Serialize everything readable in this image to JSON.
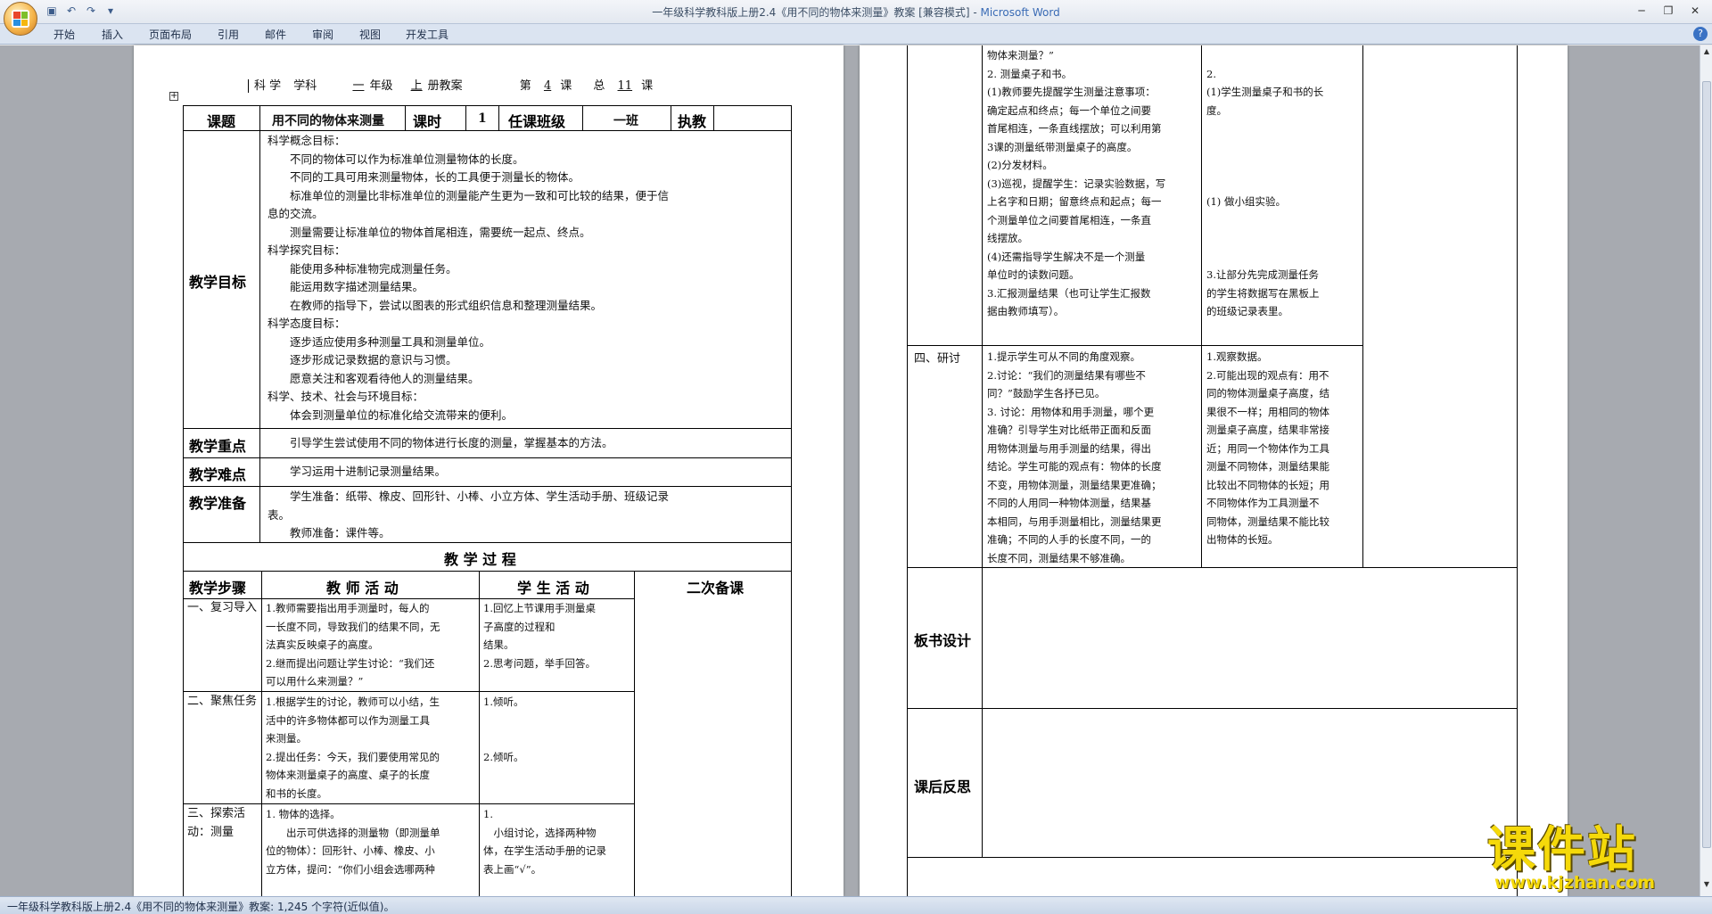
{
  "window": {
    "title": "一年级科学教科版上册2.4《用不同的物体来测量》教案 [兼容模式] - ",
    "app_name": "Microsoft Word"
  },
  "ribbon": {
    "tabs": [
      "开始",
      "插入",
      "页面布局",
      "引用",
      "邮件",
      "审阅",
      "视图",
      "开发工具"
    ]
  },
  "header_line": {
    "subject": "科 学",
    "subject_suffix": "学科",
    "grade": "一",
    "grade_suffix": "年级",
    "volume": "上",
    "volume_suffix": "册教案",
    "lesson_prefix": "第",
    "lesson_no": "4",
    "lesson_suffix": "课",
    "total_prefix": "总",
    "total_no": "11",
    "total_suffix": "课"
  },
  "info_row": {
    "topic_label": "课题",
    "topic": "用不同的物体来测量",
    "hours_label": "课时",
    "hours": "1",
    "class_label": "任课班级",
    "class": "一班",
    "teacher_label": "执教"
  },
  "objectives": {
    "label": "教学目标",
    "lines": [
      "科学概念目标：",
      "　　不同的物体可以作为标准单位测量物体的长度。",
      "　　不同的工具可用来测量物体，长的工具便于测量长的物体。",
      "　　标准单位的测量比非标准单位的测量能产生更为一致和可比较的结果，便于信",
      "息的交流。",
      "　　测量需要让标准单位的物体首尾相连，需要统一起点、终点。",
      "科学探究目标：",
      "　　能使用多种标准物完成测量任务。",
      "　　能运用数字描述测量结果。",
      "　　在教师的指导下，尝试以图表的形式组织信息和整理测量结果。",
      "科学态度目标：",
      "　　逐步适应使用多种测量工具和测量单位。",
      "　　逐步形成记录数据的意识与习惯。",
      "　　愿意关注和客观看待他人的测量结果。",
      "科学、技术、社会与环境目标：",
      "　　体会到测量单位的标准化给交流带来的便利。"
    ]
  },
  "key_point": {
    "label": "教学重点",
    "text": "　　引导学生尝试使用不同的物体进行长度的测量，掌握基本的方法。"
  },
  "difficulty": {
    "label": "教学难点",
    "text": "　　学习运用十进制记录测量结果。"
  },
  "preparation": {
    "label": "教学准备",
    "lines": [
      "　　学生准备：纸带、橡皮、回形针、小棒、小立方体、学生活动手册、班级记录",
      "表。",
      "　　教师准备：课件等。"
    ]
  },
  "process_title": "教 学 过 程",
  "process_headers": {
    "step": "教学步骤",
    "teacher": "教 师 活 动",
    "student": "学 生 活 动",
    "revise": "二次备课"
  },
  "steps_left": [
    {
      "step": "一、复习导入",
      "teacher": [
        "1.教师需要指出用手测量时，每人的",
        "一长度不同，导致我们的结果不同，无",
        "法真实反映桌子的高度。",
        "2.继而提出问题让学生讨论：“我们还",
        "可以用什么来测量？”"
      ],
      "student": [
        "1.回忆上节课用手测量桌",
        "子高度的过程和",
        "结果。",
        "",
        "2.思考问题，举手回答。"
      ]
    },
    {
      "step": "二、聚焦任务",
      "teacher": [
        "1.根据学生的讨论，教师可以小结，生",
        "活中的许多物体都可以作为测量工具",
        "来测量。",
        "2.提出任务：今天，我们要使用常见的",
        "物体来测量桌子的高度、桌子的长度",
        "和书的长度。"
      ],
      "student": [
        "1.倾听。",
        "",
        "",
        "2.倾听。"
      ]
    },
    {
      "step": "三、探索活动：测量",
      "teacher": [
        "1. 物体的选择。",
        "　　出示可供选择的测量物（即测量单",
        "位的物体）：回形针、小棒、橡皮、小",
        "立方体，提问：“你们小组会选哪两种"
      ],
      "student": [
        "1.",
        "　小组讨论，选择两种物",
        "体，在学生活动手册的记录",
        "表上画“√”。"
      ]
    }
  ],
  "right_page": {
    "explore_teacher": [
      "物体来测量？”",
      "2. 测量桌子和书。",
      "(1)教师要先提醒学生测量注意事项：",
      "确定起点和终点；每一个单位之间要",
      "首尾相连，一条直线摆放；可以利用第",
      "3课的测量纸带测量桌子的高度。",
      "(2)分发材料。",
      "(3)巡视，提醒学生：记录实验数据，写",
      "上名字和日期；留意终点和起点；每一",
      "个测量单位之间要首尾相连，一条直",
      "线摆放。",
      "(4)还需指导学生解决不是一个测量",
      "单位时的读数问题。",
      "3.汇报测量结果（也可让学生汇报数",
      "据由教师填写）。"
    ],
    "explore_student": [
      "",
      "2.",
      "(1)学生测量桌子和书的长",
      "度。",
      "",
      "",
      "",
      "",
      "(1) 做小组实验。",
      "",
      "",
      "",
      "3.让部分先完成测量任务",
      "的学生将数据写在黑板上",
      "的班级记录表里。"
    ],
    "discuss_step": "四、研讨",
    "discuss_teacher": [
      "1.提示学生可从不同的角度观察。",
      "2.讨论：“我们的测量结果有哪些不",
      "同？”鼓励学生各抒已见。",
      "3. 讨论：用物体和用手测量，哪个更",
      "准确？引导学生对比纸带正面和反面",
      "用物体测量与用手测量的结果，得出",
      "结论。学生可能的观点有：物体的长度",
      "不变，用物体测量，测量结果更准确；",
      "不同的人用同一种物体测量，结果基",
      "本相同，与用手测量相比，测量结果更",
      "准确；不同的人手的长度不同，一的",
      "长度不同，测量结果不够准确。"
    ],
    "discuss_student": [
      "1.观察数据。",
      "2.可能出现的观点有：用不",
      "同的物体测量桌子高度，结",
      "果很不一样；用相同的物体",
      "测量桌子高度，结果非常接",
      "近；用同一个物体作为工具",
      "测量不同物体，测量结果能",
      "比较出不同物体的长短；用",
      "不同物体作为工具测量不",
      "同物体，测量结果不能比较",
      "出物体的长短。"
    ],
    "board_label": "板书设计",
    "reflection_label": "课后反思"
  },
  "status_bar": "一年级科学教科版上册2.4《用不同的物体来测量》教案: 1,245 个字符(近似值)。",
  "watermark": {
    "title": "课件站",
    "url": "www.kjzhan.com"
  }
}
